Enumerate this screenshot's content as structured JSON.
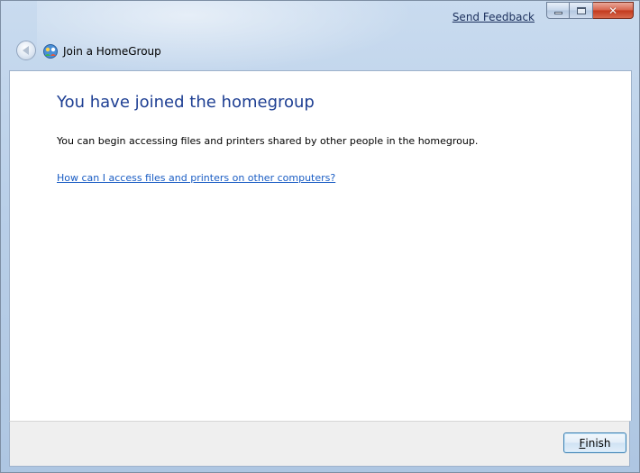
{
  "titlebar": {
    "feedback_link": "Send Feedback"
  },
  "navbar": {
    "title": "Join a HomeGroup"
  },
  "content": {
    "heading": "You have joined the homegroup",
    "body": "You can begin accessing files and printers shared by other people in the homegroup.",
    "help_link": "How can I access files and printers on other computers?"
  },
  "footer": {
    "finish_label_mnemonic": "F",
    "finish_label_rest": "inish"
  },
  "icons": {
    "back": "back-arrow-icon",
    "homegroup": "homegroup-icon",
    "minimize": "minimize-icon",
    "maximize": "maximize-icon",
    "close": "close-icon"
  },
  "colors": {
    "heading": "#1e3f93",
    "link": "#1a5dc4",
    "close_button": "#c2381c"
  }
}
